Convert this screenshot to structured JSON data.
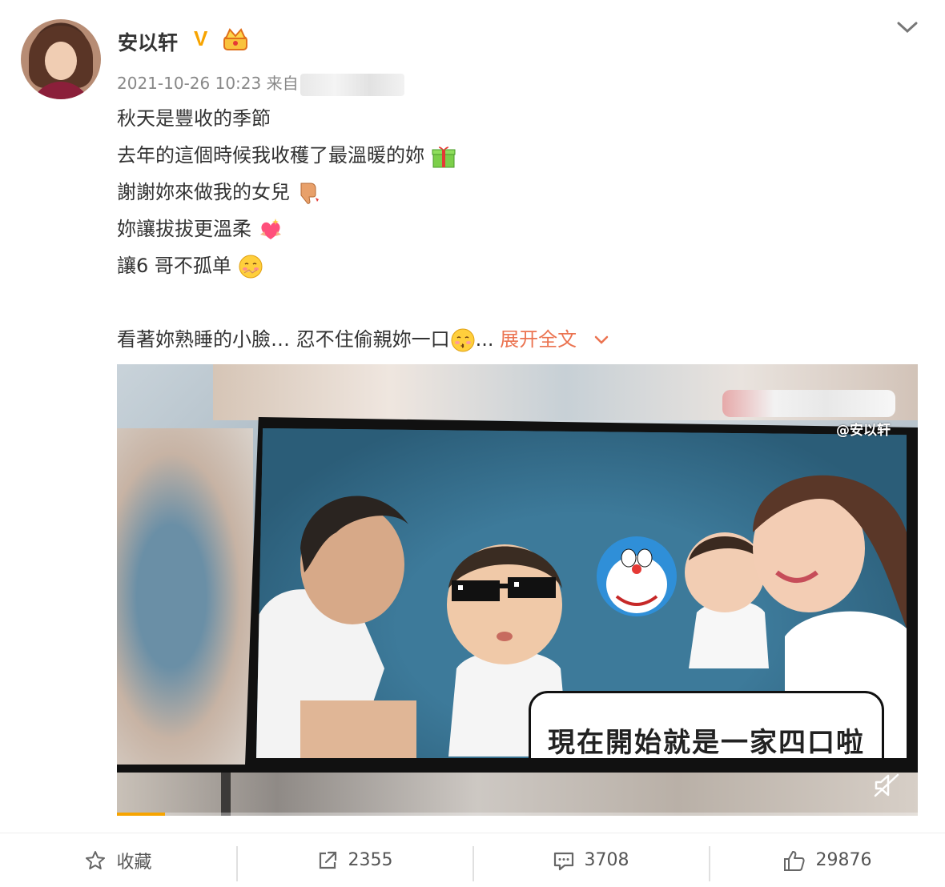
{
  "post": {
    "username": "安以轩",
    "verified_badge": "V",
    "meta": "2021-10-26 10:23 来自",
    "lines": [
      "秋天是豐收的季節",
      "去年的這個時候我收穫了最溫暖的妳",
      "謝謝妳來做我的女兒",
      "妳讓拔拔更溫柔",
      "讓6 哥不孤单"
    ],
    "last_line": "看著妳熟睡的小臉… 忍不住偷親妳一口",
    "ellipsis": "...",
    "expand_label": "展开全文"
  },
  "video": {
    "watermark": "@安以轩",
    "caption": "現在開始就是一家四口啦",
    "progress": 0.06
  },
  "actions": {
    "favorite_label": "收藏",
    "share_count": "2355",
    "comment_count": "3708",
    "like_count": "29876"
  },
  "icons": [
    "crown-icon",
    "chevron-down-icon",
    "gift-icon",
    "thumbs-down-icon",
    "heart-icon",
    "blush-face-icon",
    "kiss-face-icon",
    "mute-icon",
    "star-icon",
    "share-icon",
    "comment-icon",
    "thumbs-up-icon"
  ],
  "colors": {
    "accent": "#eb7350",
    "vip": "#f7a400",
    "text": "#333333",
    "meta": "#888888"
  }
}
